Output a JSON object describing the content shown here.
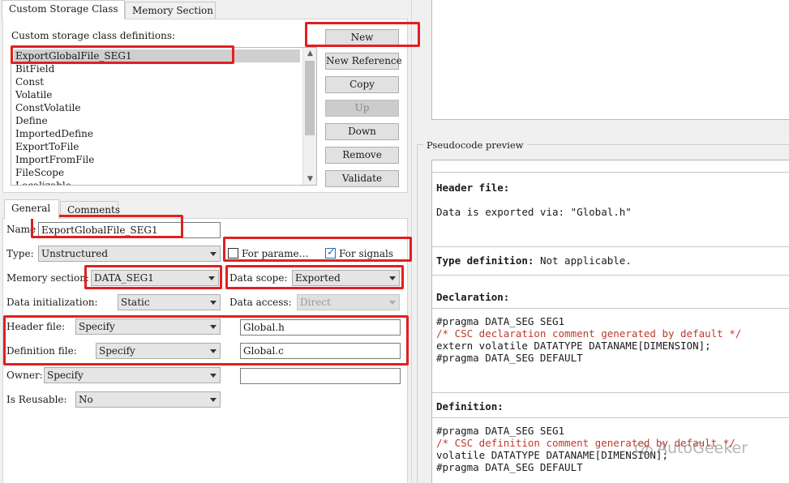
{
  "top_tabs": [
    "Custom Storage Class",
    "Memory Section"
  ],
  "definitions_label": "Custom storage class definitions:",
  "definitions": [
    "ExportGlobalFile_SEG1",
    "BitField",
    "Const",
    "Volatile",
    "ConstVolatile",
    "Define",
    "ImportedDefine",
    "ExportToFile",
    "ImportFromFile",
    "FileScope",
    "Localizable"
  ],
  "buttons": {
    "new": "New",
    "new_reference": "New Reference",
    "copy": "Copy",
    "up": "Up",
    "down": "Down",
    "remove": "Remove",
    "validate": "Validate"
  },
  "sub_tabs": [
    "General",
    "Comments"
  ],
  "form": {
    "name_label": "Name",
    "name_value": "ExportGlobalFile_SEG1",
    "type_label": "Type:",
    "type_value": "Unstructured",
    "for_parameters_label": "For parame…",
    "for_parameters_checked": false,
    "for_signals_label": "For signals",
    "for_signals_checked": true,
    "memory_section_label": "Memory section:",
    "memory_section_value": "DATA_SEG1",
    "data_scope_label": "Data scope:",
    "data_scope_value": "Exported",
    "data_init_label": "Data initialization:",
    "data_init_value": "Static",
    "data_access_label": "Data access:",
    "data_access_value": "Direct",
    "header_file_label": "Header file:",
    "header_file_mode": "Specify",
    "header_file_value": "Global.h",
    "definition_file_label": "Definition file:",
    "definition_file_mode": "Specify",
    "definition_file_value": "Global.c",
    "owner_label": "Owner:",
    "owner_mode": "Specify",
    "owner_value": "",
    "is_reusable_label": "Is Reusable:",
    "is_reusable_value": "No"
  },
  "preview": {
    "title": "Pseudocode preview",
    "header_file_title": "Header file:",
    "header_file_text": "Data is exported via: \"Global.h\"",
    "type_def_title": "Type definition:",
    "type_def_text": "Not applicable.",
    "declaration_title": "Declaration:",
    "declaration_lines": [
      {
        "text": "#pragma DATA_SEG SEG1",
        "comment": false
      },
      {
        "text": "/* CSC declaration comment generated by default */",
        "comment": true
      },
      {
        "text": "extern volatile DATATYPE DATANAME[DIMENSION];",
        "comment": false
      },
      {
        "text": "#pragma DATA_SEG DEFAULT",
        "comment": false
      }
    ],
    "definition_title": "Definition:",
    "definition_lines": [
      {
        "text": "#pragma DATA_SEG SEG1",
        "comment": false
      },
      {
        "text": "/* CSC definition comment generated by default */",
        "comment": true
      },
      {
        "text": "volatile DATATYPE DATANAME[DIMENSION];",
        "comment": false
      },
      {
        "text": "#pragma DATA_SEG DEFAULT",
        "comment": false
      }
    ]
  },
  "watermark": "AutoGeeker",
  "colors": {
    "highlight_box": "#e02020",
    "comment_text": "#c0392b",
    "checkbox_accent": "#2b6fb6"
  }
}
